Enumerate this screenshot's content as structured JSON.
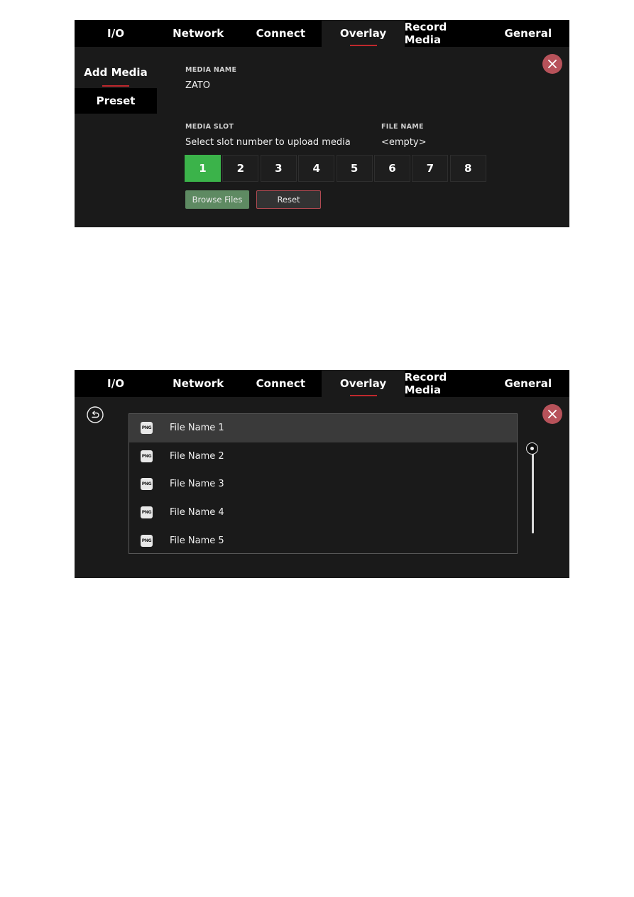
{
  "tabs": [
    {
      "label": "I/O"
    },
    {
      "label": "Network"
    },
    {
      "label": "Connect"
    },
    {
      "label": "Overlay",
      "active": true
    },
    {
      "label": "Record Media"
    },
    {
      "label": "General"
    }
  ],
  "screen1": {
    "sidenav": [
      {
        "label": "Add Media",
        "active": true
      },
      {
        "label": "Preset"
      }
    ],
    "media_name": {
      "label": "MEDIA NAME",
      "value": "ZATO"
    },
    "media_slot": {
      "label": "MEDIA SLOT",
      "instruction": "Select slot number to upload media"
    },
    "file_name": {
      "label": "FILE NAME",
      "value": "<empty>"
    },
    "slots": [
      "1",
      "2",
      "3",
      "4",
      "5",
      "6",
      "7",
      "8"
    ],
    "selected_slot": "1",
    "buttons": {
      "browse": "Browse Files",
      "reset": "Reset"
    }
  },
  "screen2": {
    "files": [
      {
        "icon": "PNG",
        "name": "File Name 1",
        "selected": true
      },
      {
        "icon": "PNG",
        "name": "File Name 2"
      },
      {
        "icon": "PNG",
        "name": "File Name 3"
      },
      {
        "icon": "PNG",
        "name": "File Name 4"
      },
      {
        "icon": "PNG",
        "name": "File Name 5"
      }
    ],
    "scroll_position": 0
  },
  "colors": {
    "accent_underline": "#c0282d",
    "selected_slot": "#3bb34a",
    "browse_button": "#5e8a62",
    "close_button": "#b7525a",
    "panel_bg": "#1a1a1a",
    "tabbar_bg": "#000000"
  }
}
